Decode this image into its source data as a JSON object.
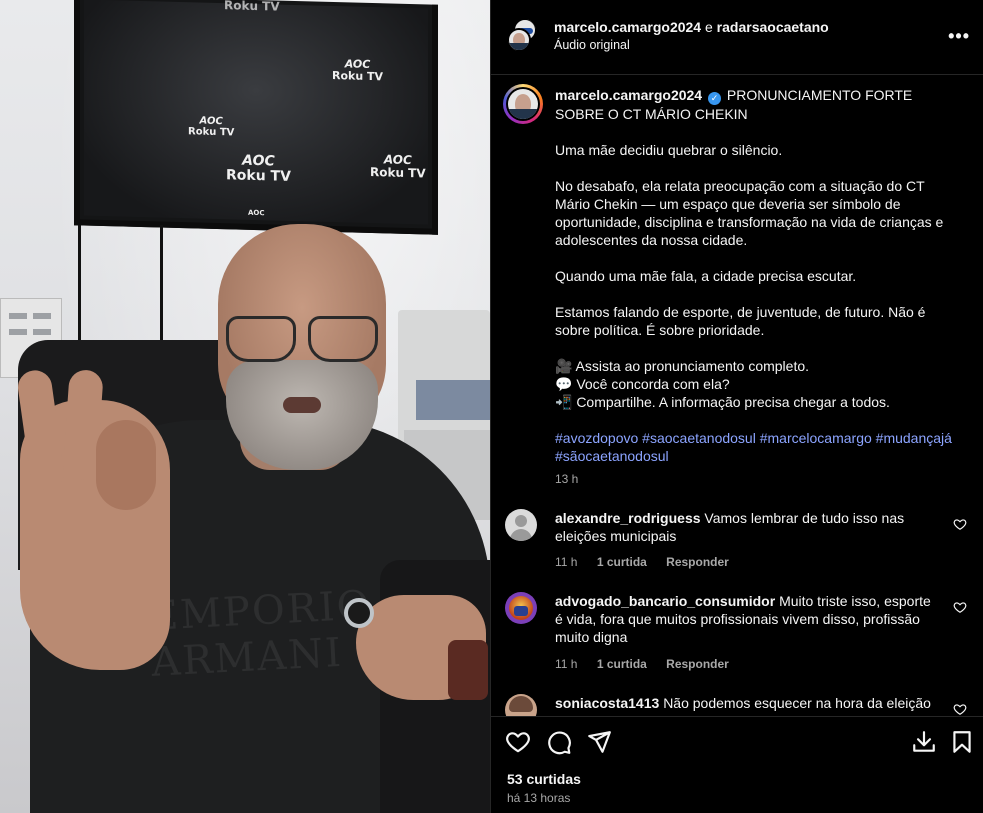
{
  "media": {
    "tv_brand_1": "AOC",
    "tv_brand_2": "Roku TV",
    "tv_top_text": "Roku TV",
    "tv_bottom_brand": "AOC",
    "shirt_text": "EMPORIO ARMANI"
  },
  "header": {
    "user1": "marcelo.camargo2024",
    "conj": "e",
    "user2": "radarsaocaetano",
    "audio": "Áudio original",
    "more_icon": "more-horizontal-icon"
  },
  "post": {
    "author": "marcelo.camargo2024",
    "verified_icon": "verified-badge-icon",
    "title": "PRONUNCIAMENTO FORTE SOBRE O CT MÁRIO CHEKIN",
    "p1": "Uma mãe decidiu quebrar o silêncio.",
    "p2": "No desabafo, ela relata preocupação com a situação do CT Mário Chekin — um espaço que deveria ser símbolo de oportunidade, disciplina e transformação na vida de crianças e adolescentes da nossa cidade.",
    "p3": "Quando uma mãe fala, a cidade precisa escutar.",
    "p4": "Estamos falando de esporte, de juventude, de futuro. Não é sobre política. É sobre prioridade.",
    "l1": "🎥 Assista ao pronunciamento completo.",
    "l2": "💬 Você concorda com ela?",
    "l3": "📲 Compartilhe. A informação precisa chegar a todos.",
    "hashtags": "#avozdopovo #saocaetanodosul #marcelocamargo #mudançajá #sãocaetanodosul",
    "time": "13 h"
  },
  "comments": [
    {
      "user": "alexandre_rodriguess",
      "text": "Vamos lembrar de tudo isso nas eleições municipais",
      "time": "11 h",
      "likes": "1 curtida",
      "reply": "Responder"
    },
    {
      "user": "advogado_bancario_consumidor",
      "text": "Muito triste isso, esporte é vida, fora que muitos profissionais vivem disso, profissão muito digna",
      "time": "11 h",
      "likes": "1 curtida",
      "reply": "Responder"
    },
    {
      "user": "soniacosta1413",
      "text": "Não podemos esquecer na hora da eleição",
      "time": "",
      "likes": "",
      "reply": ""
    }
  ],
  "actions": {
    "like_icon": "heart-icon",
    "comment_icon": "comment-icon",
    "share_icon": "share-icon",
    "download_icon": "download-icon",
    "save_icon": "bookmark-icon",
    "likes": "53 curtidas",
    "ago": "há 13 horas"
  },
  "colors": {
    "background": "#000000",
    "text": "#f5f5f5",
    "muted": "#a8a8a8",
    "hashtag": "#8ca4ff",
    "verified": "#3897f0"
  }
}
